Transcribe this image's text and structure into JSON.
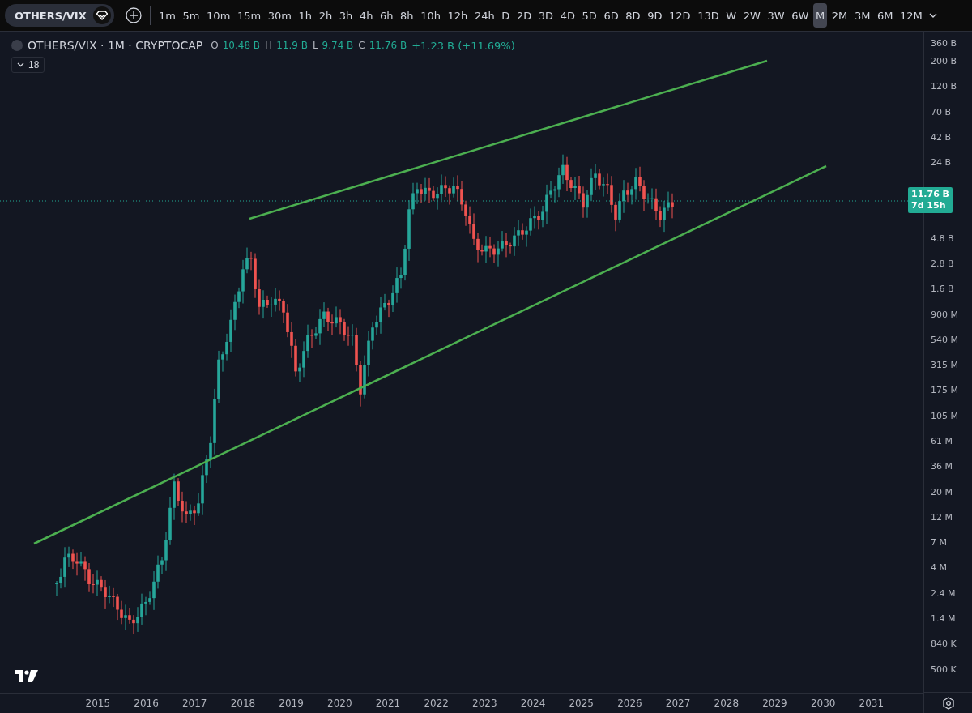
{
  "toolbar": {
    "symbol": "OTHERS/VIX",
    "intervals": [
      {
        "label": "1m",
        "selected": false
      },
      {
        "label": "5m",
        "selected": false
      },
      {
        "label": "10m",
        "selected": false
      },
      {
        "label": "15m",
        "selected": false
      },
      {
        "label": "30m",
        "selected": false
      },
      {
        "label": "1h",
        "selected": false
      },
      {
        "label": "2h",
        "selected": false
      },
      {
        "label": "3h",
        "selected": false
      },
      {
        "label": "4h",
        "selected": false
      },
      {
        "label": "6h",
        "selected": false
      },
      {
        "label": "8h",
        "selected": false
      },
      {
        "label": "10h",
        "selected": false
      },
      {
        "label": "12h",
        "selected": false
      },
      {
        "label": "24h",
        "selected": false
      },
      {
        "label": "D",
        "selected": false
      },
      {
        "label": "2D",
        "selected": false
      },
      {
        "label": "3D",
        "selected": false
      },
      {
        "label": "4D",
        "selected": false
      },
      {
        "label": "5D",
        "selected": false
      },
      {
        "label": "6D",
        "selected": false
      },
      {
        "label": "8D",
        "selected": false
      },
      {
        "label": "9D",
        "selected": false
      },
      {
        "label": "12D",
        "selected": false
      },
      {
        "label": "13D",
        "selected": false
      },
      {
        "label": "W",
        "selected": false
      },
      {
        "label": "2W",
        "selected": false
      },
      {
        "label": "3W",
        "selected": false
      },
      {
        "label": "6W",
        "selected": false
      },
      {
        "label": "M",
        "selected": true
      },
      {
        "label": "2M",
        "selected": false
      },
      {
        "label": "3M",
        "selected": false
      },
      {
        "label": "6M",
        "selected": false
      },
      {
        "label": "12M",
        "selected": false
      }
    ]
  },
  "legend": {
    "title": "OTHERS/VIX · 1M · CRYPTOCAP",
    "ohlc": [
      {
        "key": "O",
        "value": "10.48 B"
      },
      {
        "key": "H",
        "value": "11.9 B"
      },
      {
        "key": "L",
        "value": "9.74 B"
      },
      {
        "key": "C",
        "value": "11.76 B"
      }
    ],
    "change": "+1.23 B (+11.69%)",
    "indicators_count": "18"
  },
  "price_axis": {
    "labels_above": [
      "360 B",
      "200 B",
      "120 B",
      "70 B",
      "42 B",
      "24 B"
    ],
    "labels_below": [
      "4.8 B",
      "2.8 B",
      "1.6 B",
      "900 M",
      "540 M",
      "315 M",
      "175 M",
      "105 M",
      "61 M",
      "36 M",
      "20 M",
      "12 M",
      "7 M",
      "4 M",
      "2.4 M",
      "1.4 M",
      "840 K",
      "500 K"
    ],
    "price_tag": {
      "price": "11.76 B",
      "countdown": "7d 15h"
    }
  },
  "time_axis": {
    "labels": [
      "2015",
      "2016",
      "2017",
      "2018",
      "2019",
      "2020",
      "2021",
      "2022",
      "2023",
      "2024",
      "2025",
      "2026",
      "2027",
      "2028",
      "2029",
      "2030",
      "2031"
    ]
  }
}
